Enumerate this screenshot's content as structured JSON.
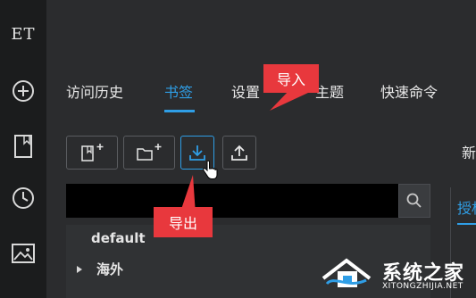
{
  "sidebar": {
    "logo": "ET",
    "items": [
      "plus-circle-icon",
      "bookmark-page-icon",
      "clock-icon",
      "image-icon"
    ]
  },
  "tabs": [
    {
      "label": "访问历史",
      "active": false
    },
    {
      "label": "书签",
      "active": true
    },
    {
      "label": "设置",
      "active": false
    },
    {
      "label": "主题",
      "active": false
    },
    {
      "label": "快速命令",
      "active": false
    }
  ],
  "toolbar": {
    "buttons": [
      "add-bookmark-icon",
      "add-folder-icon",
      "import-icon",
      "export-icon"
    ]
  },
  "search": {
    "value": "",
    "icon": "search-icon"
  },
  "tree": {
    "items": [
      {
        "label": "default",
        "expandable": false
      },
      {
        "label": "海外",
        "expandable": true
      }
    ]
  },
  "right_panel": {
    "top_text": "新",
    "tab_text": "授权"
  },
  "callouts": {
    "import": "导入",
    "export": "导出"
  },
  "watermark": {
    "name": "系统之家",
    "url": "XITONGZHIJIA.NET"
  },
  "colors": {
    "accent": "#2f9ee6",
    "callout": "#e8383d",
    "background": "#2b2c2e",
    "sidebar": "#1b1c1d"
  }
}
